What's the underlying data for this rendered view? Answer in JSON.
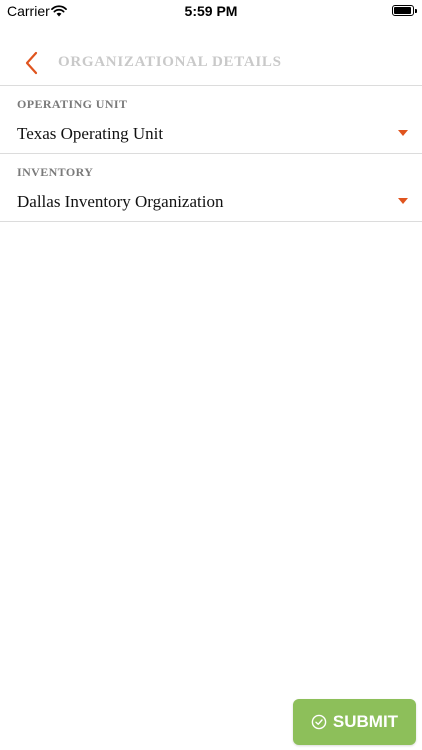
{
  "status_bar": {
    "carrier": "Carrier",
    "time": "5:59 PM",
    "wifi_icon": "wifi-icon",
    "battery_icon": "battery-icon"
  },
  "nav": {
    "title": "ORGANIZATIONAL DETAILS",
    "back_icon": "chevron-left-icon"
  },
  "fields": [
    {
      "label": "OPERATING UNIT",
      "value": "Texas Operating Unit",
      "icon": "caret-down-icon"
    },
    {
      "label": "INVENTORY",
      "value": "Dallas Inventory Organization",
      "icon": "caret-down-icon"
    }
  ],
  "submit": {
    "label": "SUBMIT",
    "icon": "check-circle-icon"
  },
  "colors": {
    "accent": "#e0541e",
    "submit_bg": "#8dbf5a",
    "title_gray": "#c9c9c9",
    "label_gray": "#7a7a7a",
    "divider": "#dcdcdc"
  }
}
